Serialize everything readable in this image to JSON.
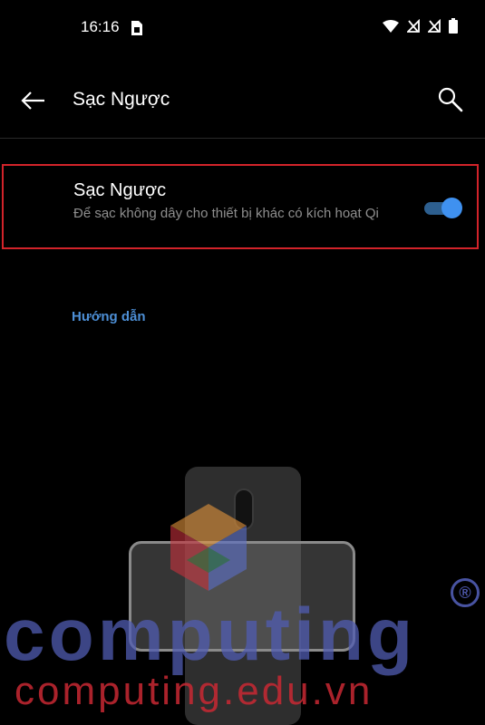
{
  "status_bar": {
    "time": "16:16",
    "icons": [
      "sim-card-icon",
      "wifi-icon",
      "no-signal-icon",
      "no-signal-icon",
      "battery-icon"
    ]
  },
  "app_bar": {
    "title": "Sạc Ngược",
    "back_icon": "arrow-left-icon",
    "search_icon": "search-icon"
  },
  "setting": {
    "title": "Sạc Ngược",
    "description": "Để sạc không dây cho thiết bị khác có kích hoạt Qi",
    "toggle_on": true
  },
  "guide": {
    "label": "Hướng dẫn"
  },
  "watermark": {
    "brand": "computing",
    "registered": "®",
    "url": "computing.edu.vn"
  },
  "colors": {
    "background": "#000000",
    "accent": "#3f91f0",
    "link": "#4d8fd6",
    "highlight_border": "#d2232a",
    "secondary_text": "#8e8e8e"
  }
}
